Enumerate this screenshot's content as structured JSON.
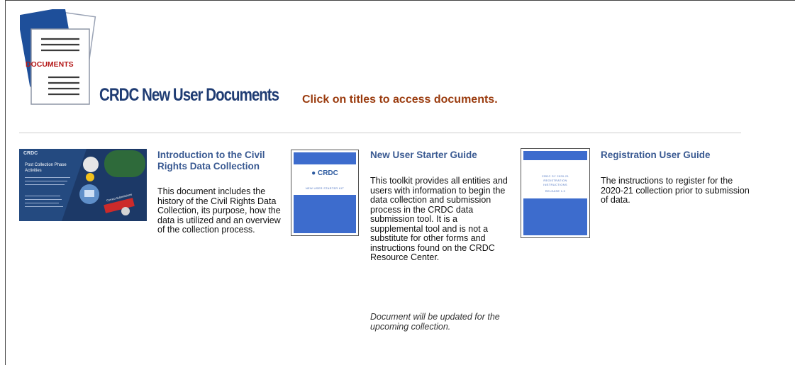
{
  "header": {
    "logo_text": "DOCUMENTS",
    "title": "CRDC New User Documents",
    "subtitle": "Click on titles to access documents."
  },
  "documents": [
    {
      "title": "Introduction to the Civil Rights Data Collection",
      "description": "This document includes the history of the Civil Rights Data Collection, its purpose, how the data is utilized and an overview of the collection process.",
      "thumbnail": {
        "brand": "CRDC",
        "heading": "Post Collection Phase Activities",
        "badge": "Correct Submissions"
      }
    },
    {
      "title": "New User Starter Guide",
      "description": "This toolkit provides all entities and users with information to begin the data collection and submission process in the CRDC data submission tool. It is a supplemental tool and is not a substitute for other forms and instructions found on the CRDC Resource Center.",
      "note": "Document will be updated for the upcoming collection.",
      "thumbnail": {
        "brand": "CRDC",
        "caption": "NEW USER STARTER KIT"
      }
    },
    {
      "title": "Registration User Guide",
      "description": "The instructions to register for the 2020-21 collection prior to submission of data.",
      "thumbnail": {
        "caption": "CRDC SY 2020-21 REGISTRATION INSTRUCTIONS",
        "version": "RELEASE 1.0"
      }
    }
  ]
}
